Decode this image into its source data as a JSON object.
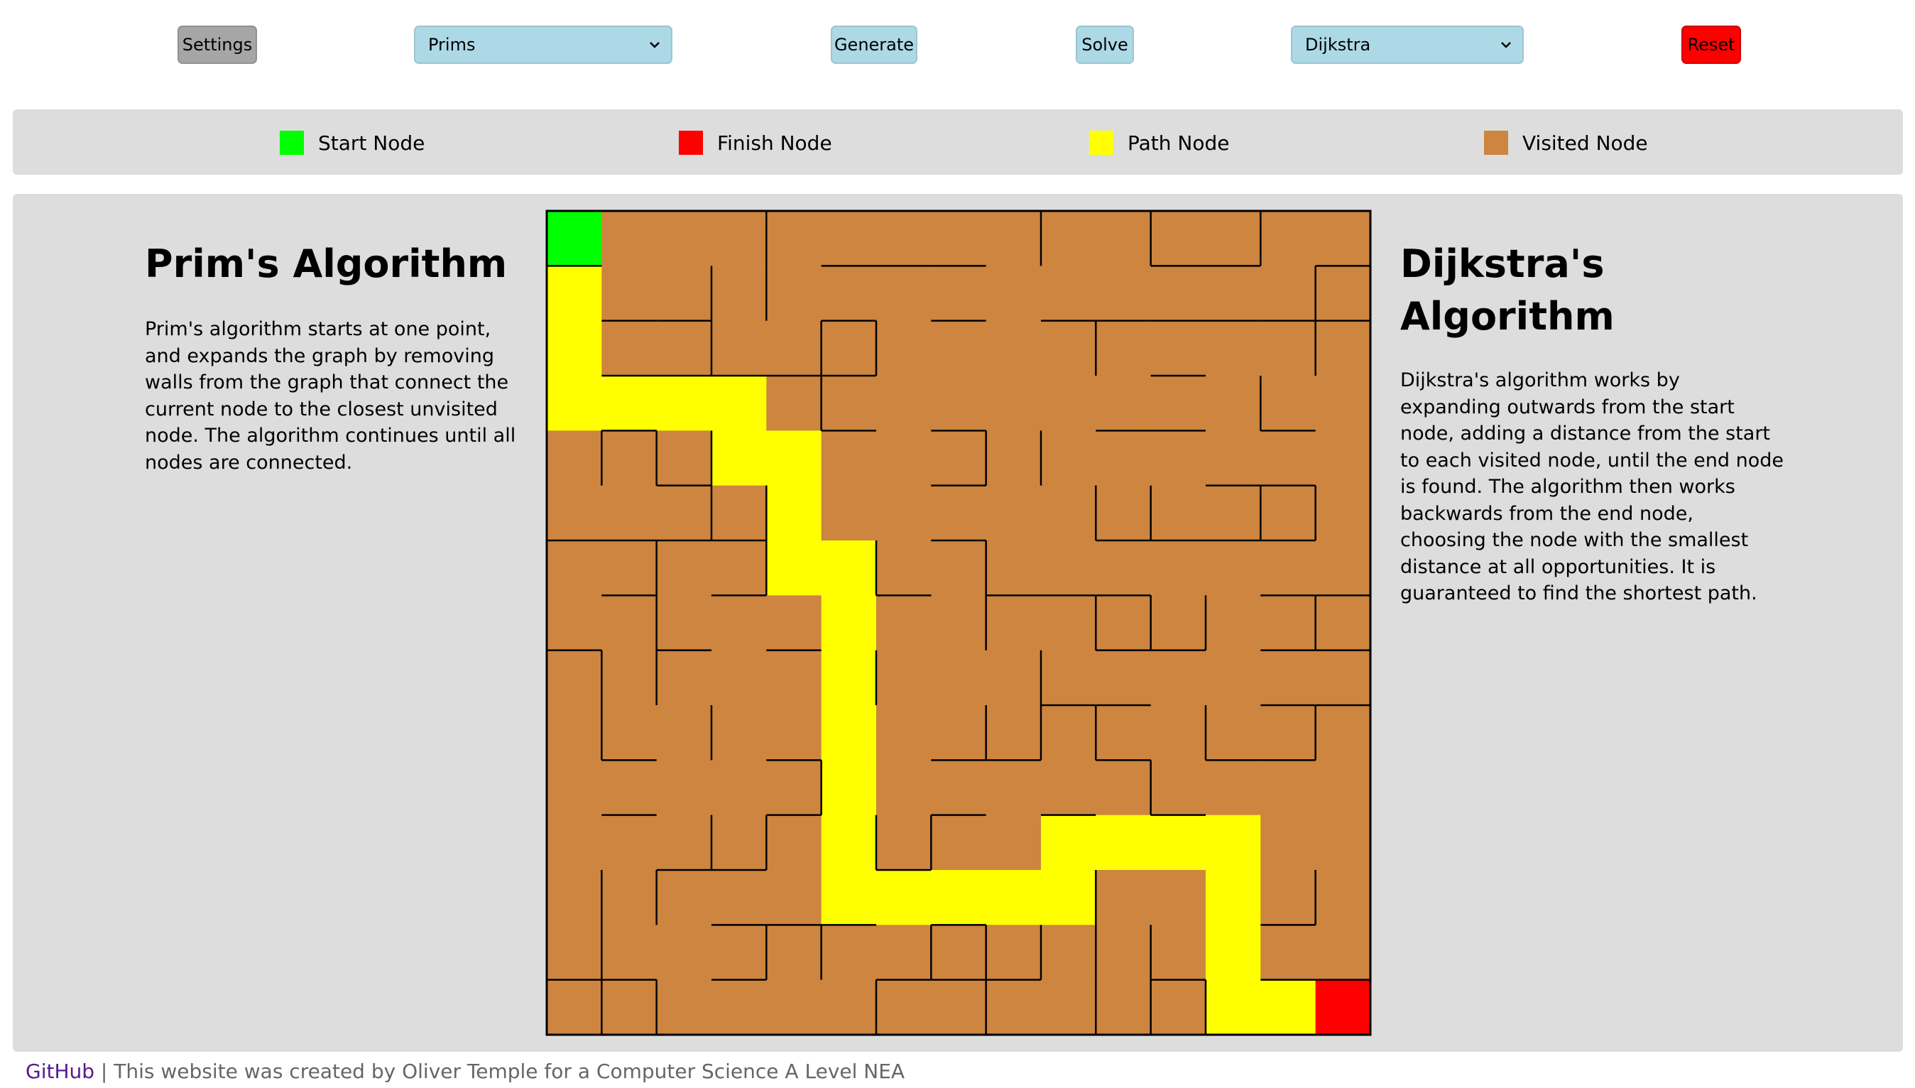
{
  "toolbar": {
    "settings_label": "Settings",
    "generation_algorithm": "Prims",
    "generate_label": "Generate",
    "solve_label": "Solve",
    "solve_algorithm": "Dijkstra",
    "reset_label": "Reset"
  },
  "legend": {
    "items": [
      {
        "label": "Start Node",
        "color": "#00ff00"
      },
      {
        "label": "Finish Node",
        "color": "#ff0000"
      },
      {
        "label": "Path Node",
        "color": "#ffff00"
      },
      {
        "label": "Visited Node",
        "color": "#cd853f"
      }
    ]
  },
  "left_panel": {
    "title": "Prim's Algorithm",
    "text": "Prim's algorithm starts at one point, and expands the graph by removing walls from the graph that connect the current node to the closest unvisited node. The algorithm continues until all nodes are connected."
  },
  "right_panel": {
    "title": "Dijkstra's Algorithm",
    "text": "Dijkstra's algorithm works by expanding outwards from the start node, adding a distance from the start to each visited node, until the end node is found. The algorithm then works backwards from the end node, choosing the node with the smallest distance at all opportunities. It is guaranteed to find the shortest path."
  },
  "maze": {
    "rows": 15,
    "cols": 15,
    "colors": {
      "visited": "#cd853f",
      "start": "#00ff00",
      "finish": "#ff0000",
      "path": "#ffff00",
      "wall": "#000000"
    },
    "start": [
      0,
      0
    ],
    "finish": [
      14,
      14
    ],
    "path": [
      [
        1,
        0
      ],
      [
        2,
        0
      ],
      [
        3,
        0
      ],
      [
        3,
        1
      ],
      [
        3,
        2
      ],
      [
        3,
        3
      ],
      [
        4,
        3
      ],
      [
        4,
        4
      ],
      [
        5,
        4
      ],
      [
        6,
        4
      ],
      [
        6,
        5
      ],
      [
        7,
        5
      ],
      [
        8,
        5
      ],
      [
        9,
        5
      ],
      [
        10,
        5
      ],
      [
        11,
        5
      ],
      [
        12,
        5
      ],
      [
        12,
        6
      ],
      [
        12,
        7
      ],
      [
        12,
        8
      ],
      [
        12,
        9
      ],
      [
        11,
        9
      ],
      [
        11,
        10
      ],
      [
        11,
        11
      ],
      [
        11,
        12
      ],
      [
        12,
        12
      ],
      [
        13,
        12
      ],
      [
        14,
        12
      ],
      [
        14,
        13
      ]
    ]
  },
  "footer": {
    "link": "GitHub",
    "separator": " | ",
    "text": "This website was created by Oliver Temple for a Computer Science A Level NEA"
  }
}
